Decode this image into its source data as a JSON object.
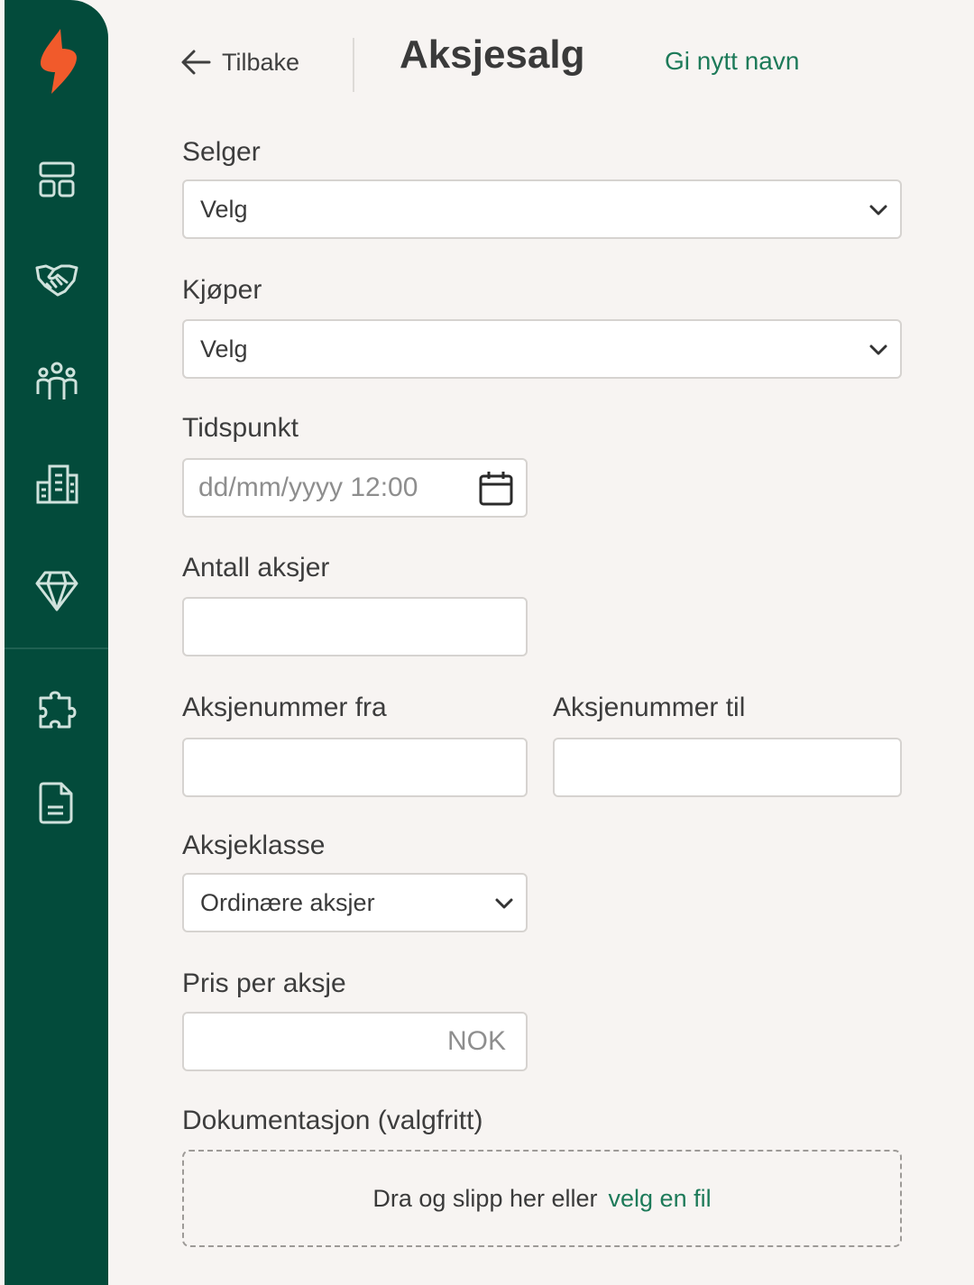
{
  "header": {
    "back_label": "Tilbake",
    "title": "Aksjesalg",
    "rename_label": "Gi nytt navn"
  },
  "sidebar": {
    "brand_color": "#034b3b",
    "logo_color": "#f15a2b",
    "items": [
      {
        "icon": "dashboard-icon"
      },
      {
        "icon": "handshake-icon"
      },
      {
        "icon": "people-icon"
      },
      {
        "icon": "buildings-icon"
      },
      {
        "icon": "diamond-icon"
      },
      {
        "icon": "puzzle-icon"
      },
      {
        "icon": "document-icon"
      }
    ]
  },
  "form": {
    "seller": {
      "label": "Selger",
      "value": "Velg"
    },
    "buyer": {
      "label": "Kjøper",
      "value": "Velg"
    },
    "time": {
      "label": "Tidspunkt",
      "placeholder": "dd/mm/yyyy 12:00"
    },
    "share_count": {
      "label": "Antall aksjer",
      "value": ""
    },
    "share_from": {
      "label": "Aksjenummer fra",
      "value": ""
    },
    "share_to": {
      "label": "Aksjenummer til",
      "value": ""
    },
    "share_class": {
      "label": "Aksjeklasse",
      "value": "Ordinære aksjer"
    },
    "price": {
      "label": "Pris per aksje",
      "value": "",
      "suffix": "NOK"
    },
    "documentation": {
      "label": "Dokumentasjon (valgfritt)",
      "drop_text": "Dra og slipp her eller",
      "choose_file": "velg en fil"
    }
  }
}
